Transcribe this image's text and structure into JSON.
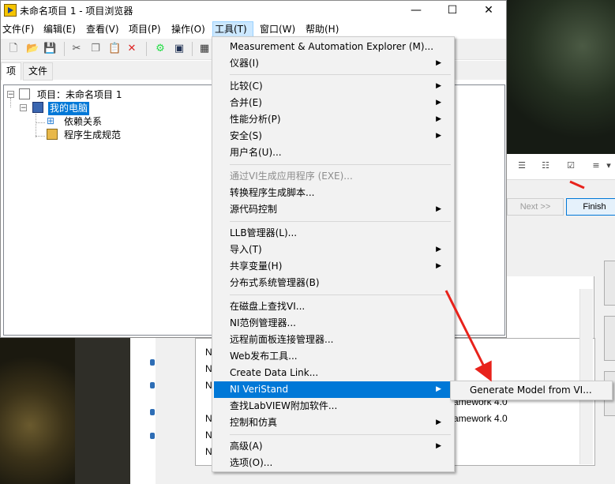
{
  "window": {
    "title": "未命名项目 1 - 项目浏览器",
    "controls": {
      "minimize": "—",
      "maximize": "☐",
      "close": "✕"
    }
  },
  "menubar": [
    {
      "label": "文件(F)"
    },
    {
      "label": "编辑(E)"
    },
    {
      "label": "查看(V)"
    },
    {
      "label": "项目(P)"
    },
    {
      "label": "操作(O)"
    },
    {
      "label": "工具(T)"
    },
    {
      "label": "窗口(W)"
    },
    {
      "label": "帮助(H)"
    }
  ],
  "tabs": [
    {
      "label": "项"
    },
    {
      "label": "文件"
    }
  ],
  "tree": {
    "project": "项目：未命名项目 1",
    "computer": "我的电脑",
    "dependencies": "依赖关系",
    "build_specs": "程序生成规范"
  },
  "tools_menu": {
    "items": [
      "Measurement & Automation Explorer (M)...",
      "仪器(I)",
      "比较(C)",
      "合并(E)",
      "性能分析(P)",
      "安全(S)",
      "用户名(U)...",
      "通过VI生成应用程序 (EXE)...",
      "转换程序生成脚本...",
      "源代码控制",
      "LLB管理器(L)...",
      "导入(T)",
      "共享变量(H)",
      "分布式系统管理器(B)",
      "在磁盘上查找VI...",
      "NI范例管理器...",
      "远程前面板连接管理器...",
      "Web发布工具...",
      "Create Data Link...",
      "NI VeriStand",
      "查找LabVIEW附加软件...",
      "控制和仿真",
      "高级(A)",
      "选项(O)..."
    ]
  },
  "submenu": {
    "item": "Generate Model from VI..."
  },
  "background_window": {
    "next_label": "Next >>",
    "finish_label": "Finish",
    "list_rows": [
      "N",
      "N",
      "N",
      "ramework 4.0",
      "ramework 4.0",
      "N",
      "N",
      "N"
    ]
  },
  "colors": {
    "highlight": "#0078d7",
    "arrow": "#e8221b",
    "menu_bg": "#f2f2f2"
  }
}
